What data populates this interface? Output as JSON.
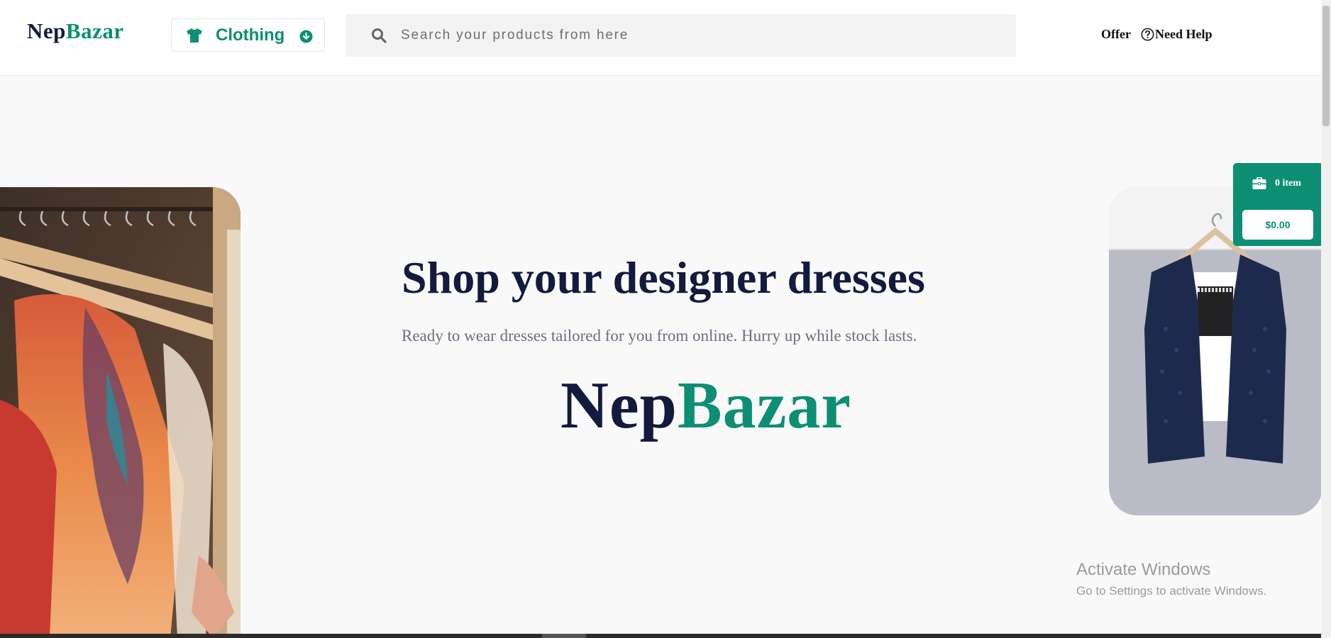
{
  "header": {
    "logo": {
      "part1": "Nep",
      "part2": "Bazar"
    },
    "category": {
      "label": "Clothing",
      "icon": "tshirt-icon",
      "chevron_icon": "chevron-down-circle-icon"
    },
    "search": {
      "placeholder": "Search your products from here",
      "value": "",
      "icon": "search-icon"
    },
    "links": {
      "offer": "Offer",
      "help": "Need Help",
      "help_icon": "question-circle-icon"
    }
  },
  "hero": {
    "headline": "Shop your designer dresses",
    "subtext": "Ready to wear dresses tailored for you from online. Hurry up while stock lasts.",
    "brand": {
      "part1": "Nep",
      "part2": "Bazar"
    }
  },
  "cart": {
    "icon": "briefcase-icon",
    "items_label": "0 item",
    "total": "$0.00"
  },
  "watermark": {
    "title": "Activate Windows",
    "subtitle": "Go to Settings to activate Windows."
  },
  "colors": {
    "brand_green": "#0d8f73",
    "navy": "#131a3d",
    "page_bg": "#f9f9f9"
  }
}
